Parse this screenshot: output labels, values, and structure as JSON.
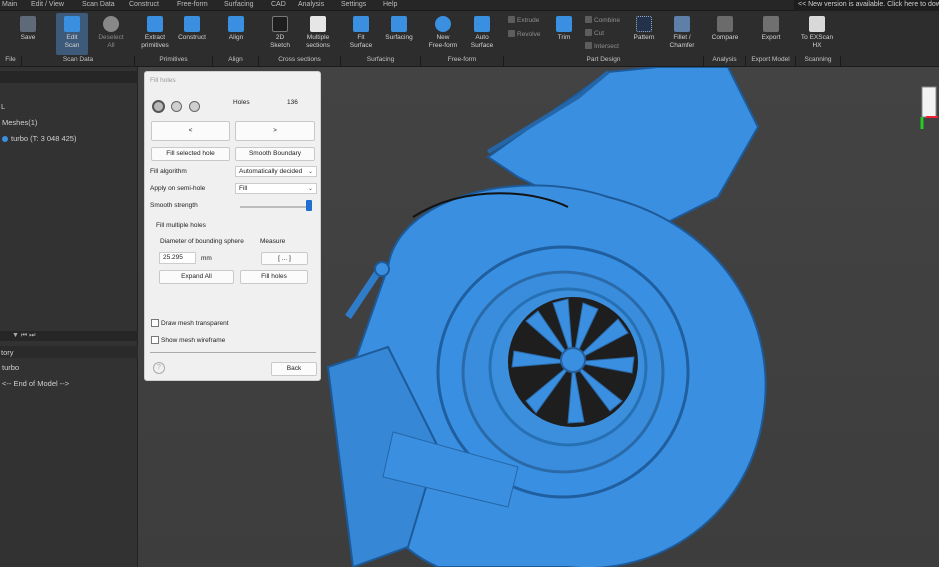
{
  "menu": [
    "Main",
    "Edit / View",
    "Scan Data",
    "Construct",
    "Free-form",
    "Surfacing",
    "CAD",
    "Analysis",
    "Settings",
    "Help"
  ],
  "notice": "<< New version is available. Click here to dow",
  "ribbon": {
    "buttons": [
      {
        "label": "Save",
        "icon": "save-icon"
      },
      {
        "label": "Edit\nScan",
        "icon": "edit-scan-icon"
      },
      {
        "label": "Deselect\nAll",
        "icon": "deselect-icon"
      },
      {
        "label": "Extract\nprimitives",
        "icon": "extract-primitives-icon"
      },
      {
        "label": "Construct",
        "icon": "construct-icon"
      },
      {
        "label": "Align",
        "icon": "align-icon"
      },
      {
        "label": "2D\nSketch",
        "icon": "sketch-icon"
      },
      {
        "label": "Multiple\nsections",
        "icon": "sections-icon"
      },
      {
        "label": "Fit\nSurface",
        "icon": "fit-surface-icon"
      },
      {
        "label": "Surfacing",
        "icon": "surfacing-icon"
      },
      {
        "label": "New\nFree-form",
        "icon": "freeform-icon"
      },
      {
        "label": "Auto\nSurface",
        "icon": "auto-surface-icon"
      },
      {
        "label": "Trim",
        "icon": "trim-icon"
      },
      {
        "label": "Pattern",
        "icon": "pattern-icon"
      },
      {
        "label": "Fillet /\nChamfer",
        "icon": "fillet-icon"
      },
      {
        "label": "Compare",
        "icon": "compare-icon"
      },
      {
        "label": "Export",
        "icon": "export-icon"
      },
      {
        "label": "To EXScan\nHX",
        "icon": "exscan-icon"
      }
    ],
    "small": [
      "Extrude",
      "Revolve",
      "Combine",
      "Cut",
      "Intersect"
    ],
    "groups": [
      "File",
      "Scan Data",
      "Primitives",
      "Align",
      "Cross sections",
      "Surfacing",
      "Free-form",
      "Part Design",
      "Analysis",
      "Export Model",
      "Scanning"
    ]
  },
  "left": {
    "tree_root": "L",
    "meshes": "Meshes(1)",
    "mesh_item": "turbo (T: 3 048 425)",
    "history_title": "tory",
    "history_item": "turbo",
    "history_end": "<-- End of Model -->"
  },
  "dialog": {
    "title": "Fill holes",
    "holes_label": "Holes",
    "holes_count": "136",
    "prev": "<",
    "next": ">",
    "fill_selected": "Fill selected hole",
    "smooth_boundary": "Smooth Boundary",
    "fill_algorithm_label": "Fill algorithm",
    "fill_algorithm_value": "Automatically decided",
    "semi_hole_label": "Apply on semi-hole",
    "semi_hole_value": "Fill",
    "smooth_strength_label": "Smooth strength",
    "smooth_strength_level": 1.0,
    "fill_multiple": "Fill multiple holes",
    "diameter_label": "Diameter of bounding sphere",
    "measure_label": "Measure",
    "diameter_value": "25.295",
    "unit": "mm",
    "measure_btn": "[ ... ]",
    "expand_all": "Expand All",
    "fill_holes": "Fill holes",
    "transparent": "Draw mesh transparent",
    "wireframe": "Show mesh wireframe",
    "help": "?",
    "back": "Back"
  },
  "colors": {
    "mesh": "#3b8fe0",
    "accent": "#3b8fe0"
  }
}
